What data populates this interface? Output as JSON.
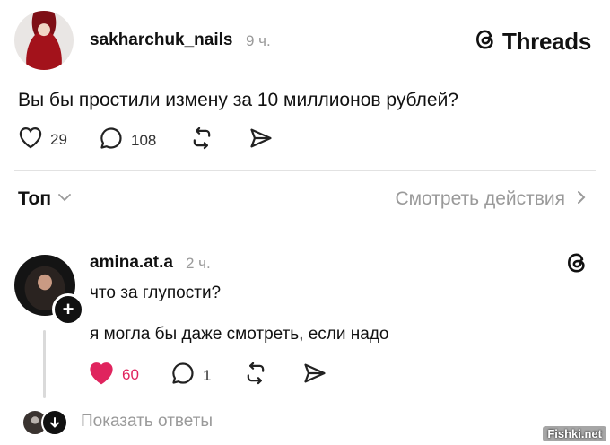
{
  "post": {
    "username": "sakharchuk_nails",
    "time": "9 ч.",
    "text": "Вы бы простили измену за 10 миллионов рублей?",
    "likes": "29",
    "replies": "108"
  },
  "brand": {
    "name": "Threads"
  },
  "sort": {
    "label": "Топ",
    "view_activity": "Смотреть действия"
  },
  "reply": {
    "username": "amina.at.a",
    "time": "2 ч.",
    "line1": "что за глупости?",
    "line2": "я могла бы даже смотреть, если надо",
    "likes": "60",
    "liked": true,
    "replies": "1",
    "show_replies": "Показать ответы"
  },
  "watermark": "Fishki.net",
  "colors": {
    "like_active": "#e0245e",
    "muted_text": "#9a9a9a",
    "divider": "#e2e2e2"
  }
}
